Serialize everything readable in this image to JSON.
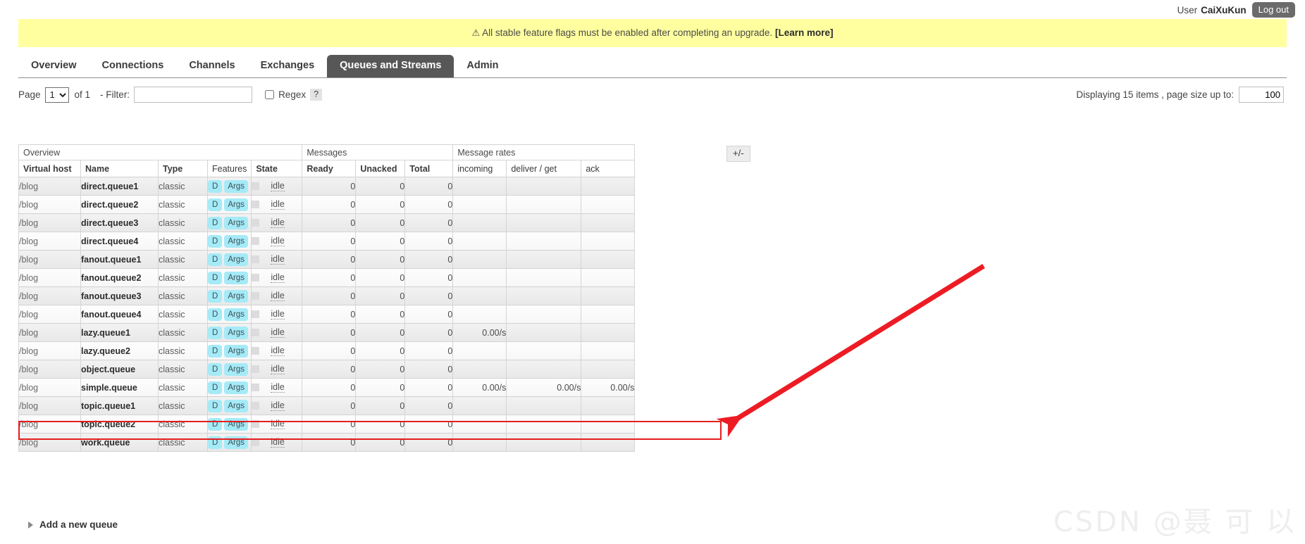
{
  "user_bar": {
    "user_label": "User",
    "user_name": "CaiXuKun",
    "logout_label": "Log out"
  },
  "banner": {
    "warn_icon": "warning-triangle-icon",
    "warn_glyph": "⚠",
    "message": "All stable feature flags must be enabled after completing an upgrade.",
    "link_text": "[Learn more]",
    "background": "#ffffa0"
  },
  "tabs": [
    {
      "label": "Overview",
      "active": false
    },
    {
      "label": "Connections",
      "active": false
    },
    {
      "label": "Channels",
      "active": false
    },
    {
      "label": "Exchanges",
      "active": false
    },
    {
      "label": "Queues and Streams",
      "active": true
    },
    {
      "label": "Admin",
      "active": false
    }
  ],
  "active_tab_color": "#575757",
  "filter_bar": {
    "page_label": "Page",
    "page_value": "1",
    "page_options": [
      "1"
    ],
    "of_label": "of 1",
    "filter_label": "- Filter:",
    "filter_value": "",
    "filter_placeholder": "",
    "regex_label": "Regex",
    "regex_checked": false,
    "help_label": "?",
    "displaying_label": "Displaying 15 items , page size up to:",
    "page_size_value": "100"
  },
  "table": {
    "group_headers": [
      {
        "label": "Overview",
        "span": 5
      },
      {
        "label": "Messages",
        "span": 3
      },
      {
        "label": "Message rates",
        "span": 3
      }
    ],
    "columns": [
      {
        "label": "Virtual host",
        "style": "bold"
      },
      {
        "label": "Name",
        "style": "bold"
      },
      {
        "label": "Type",
        "style": "bold"
      },
      {
        "label": "Features",
        "style": "normal"
      },
      {
        "label": "State",
        "style": "bold"
      },
      {
        "label": "Ready",
        "style": "bold"
      },
      {
        "label": "Unacked",
        "style": "bold"
      },
      {
        "label": "Total",
        "style": "bold"
      },
      {
        "label": "incoming",
        "style": "normal"
      },
      {
        "label": "deliver / get",
        "style": "normal"
      },
      {
        "label": "ack",
        "style": "normal"
      }
    ],
    "plus_minus_label": "+/-",
    "feature_tags": {
      "durable": "D",
      "args": "Args"
    },
    "rows": [
      {
        "vhost": "/blog",
        "name": "direct.queue1",
        "type": "classic",
        "features": [
          "D",
          "Args"
        ],
        "state": "idle",
        "ready": "0",
        "unacked": "0",
        "total": "0",
        "incoming": "",
        "deliver_get": "",
        "ack": "",
        "highlight": false
      },
      {
        "vhost": "/blog",
        "name": "direct.queue2",
        "type": "classic",
        "features": [
          "D",
          "Args"
        ],
        "state": "idle",
        "ready": "0",
        "unacked": "0",
        "total": "0",
        "incoming": "",
        "deliver_get": "",
        "ack": "",
        "highlight": false
      },
      {
        "vhost": "/blog",
        "name": "direct.queue3",
        "type": "classic",
        "features": [
          "D",
          "Args"
        ],
        "state": "idle",
        "ready": "0",
        "unacked": "0",
        "total": "0",
        "incoming": "",
        "deliver_get": "",
        "ack": "",
        "highlight": false
      },
      {
        "vhost": "/blog",
        "name": "direct.queue4",
        "type": "classic",
        "features": [
          "D",
          "Args"
        ],
        "state": "idle",
        "ready": "0",
        "unacked": "0",
        "total": "0",
        "incoming": "",
        "deliver_get": "",
        "ack": "",
        "highlight": false
      },
      {
        "vhost": "/blog",
        "name": "fanout.queue1",
        "type": "classic",
        "features": [
          "D",
          "Args"
        ],
        "state": "idle",
        "ready": "0",
        "unacked": "0",
        "total": "0",
        "incoming": "",
        "deliver_get": "",
        "ack": "",
        "highlight": false
      },
      {
        "vhost": "/blog",
        "name": "fanout.queue2",
        "type": "classic",
        "features": [
          "D",
          "Args"
        ],
        "state": "idle",
        "ready": "0",
        "unacked": "0",
        "total": "0",
        "incoming": "",
        "deliver_get": "",
        "ack": "",
        "highlight": false
      },
      {
        "vhost": "/blog",
        "name": "fanout.queue3",
        "type": "classic",
        "features": [
          "D",
          "Args"
        ],
        "state": "idle",
        "ready": "0",
        "unacked": "0",
        "total": "0",
        "incoming": "",
        "deliver_get": "",
        "ack": "",
        "highlight": false
      },
      {
        "vhost": "/blog",
        "name": "fanout.queue4",
        "type": "classic",
        "features": [
          "D",
          "Args"
        ],
        "state": "idle",
        "ready": "0",
        "unacked": "0",
        "total": "0",
        "incoming": "",
        "deliver_get": "",
        "ack": "",
        "highlight": false
      },
      {
        "vhost": "/blog",
        "name": "lazy.queue1",
        "type": "classic",
        "features": [
          "D",
          "Args"
        ],
        "state": "idle",
        "ready": "0",
        "unacked": "0",
        "total": "0",
        "incoming": "0.00/s",
        "deliver_get": "",
        "ack": "",
        "highlight": false
      },
      {
        "vhost": "/blog",
        "name": "lazy.queue2",
        "type": "classic",
        "features": [
          "D",
          "Args"
        ],
        "state": "idle",
        "ready": "0",
        "unacked": "0",
        "total": "0",
        "incoming": "",
        "deliver_get": "",
        "ack": "",
        "highlight": false
      },
      {
        "vhost": "/blog",
        "name": "object.queue",
        "type": "classic",
        "features": [
          "D",
          "Args"
        ],
        "state": "idle",
        "ready": "0",
        "unacked": "0",
        "total": "0",
        "incoming": "",
        "deliver_get": "",
        "ack": "",
        "highlight": false
      },
      {
        "vhost": "/blog",
        "name": "simple.queue",
        "type": "classic",
        "features": [
          "D",
          "Args"
        ],
        "state": "idle",
        "ready": "0",
        "unacked": "0",
        "total": "0",
        "incoming": "0.00/s",
        "deliver_get": "0.00/s",
        "ack": "0.00/s",
        "highlight": true
      },
      {
        "vhost": "/blog",
        "name": "topic.queue1",
        "type": "classic",
        "features": [
          "D",
          "Args"
        ],
        "state": "idle",
        "ready": "0",
        "unacked": "0",
        "total": "0",
        "incoming": "",
        "deliver_get": "",
        "ack": "",
        "highlight": false
      },
      {
        "vhost": "/blog",
        "name": "topic.queue2",
        "type": "classic",
        "features": [
          "D",
          "Args"
        ],
        "state": "idle",
        "ready": "0",
        "unacked": "0",
        "total": "0",
        "incoming": "",
        "deliver_get": "",
        "ack": "",
        "highlight": false
      },
      {
        "vhost": "/blog",
        "name": "work.queue",
        "type": "classic",
        "features": [
          "D",
          "Args"
        ],
        "state": "idle",
        "ready": "0",
        "unacked": "0",
        "total": "0",
        "incoming": "",
        "deliver_get": "",
        "ack": "",
        "highlight": false
      }
    ]
  },
  "add_queue": {
    "label": "Add a new queue"
  },
  "annotation": {
    "arrow_color": "#ed1c24",
    "highlight_color": "#e51e1e"
  },
  "watermark": {
    "text": "CSDN @聂 可 以"
  }
}
